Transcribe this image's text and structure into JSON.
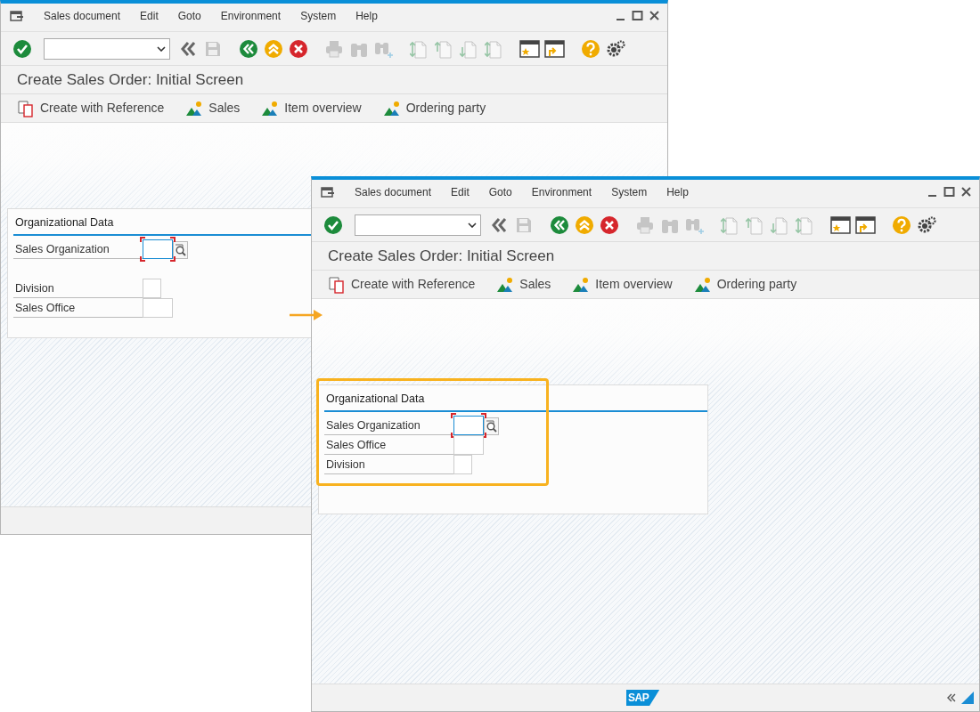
{
  "windows": [
    {
      "menu": [
        {
          "label": "Sales document"
        },
        {
          "label": "Edit"
        },
        {
          "label": "Goto"
        },
        {
          "label": "Environment"
        },
        {
          "label": "System"
        },
        {
          "label": "Help"
        }
      ],
      "toolbar": [
        {
          "kind": "check",
          "disabled": false
        },
        {
          "kind": "command_field",
          "disabled": false
        },
        {
          "kind": "chevrons",
          "disabled": false
        },
        {
          "kind": "save",
          "disabled": true
        },
        {
          "kind": "back",
          "disabled": false
        },
        {
          "kind": "exit",
          "disabled": false
        },
        {
          "kind": "cancel",
          "disabled": false
        },
        {
          "kind": "print",
          "disabled": true
        },
        {
          "kind": "find",
          "disabled": true
        },
        {
          "kind": "find_next",
          "disabled": true
        },
        {
          "kind": "first_page",
          "disabled": true
        },
        {
          "kind": "prev_page",
          "disabled": true
        },
        {
          "kind": "next_page",
          "disabled": true
        },
        {
          "kind": "last_page",
          "disabled": true
        },
        {
          "kind": "new_session",
          "disabled": false
        },
        {
          "kind": "shortcut",
          "disabled": false
        },
        {
          "kind": "help",
          "disabled": false
        },
        {
          "kind": "settings",
          "disabled": false
        }
      ],
      "title": "Create Sales Order: Initial Screen",
      "app_toolbar": [
        {
          "kind": "reference",
          "label": "Create with Reference"
        },
        {
          "kind": "overview",
          "label": "Sales"
        },
        {
          "kind": "overview",
          "label": "Item overview"
        },
        {
          "kind": "overview",
          "label": "Ordering party"
        }
      ],
      "group": {
        "title": "Organizational Data",
        "highlighted": false,
        "fields": [
          {
            "label": "Sales Organization",
            "kind": "long",
            "required": true,
            "focused": true,
            "search_help": true,
            "gap_before": false
          },
          {
            "label": "Division",
            "kind": "short",
            "required": false,
            "focused": false,
            "search_help": false,
            "gap_before": true
          },
          {
            "label": "Sales Office",
            "kind": "long",
            "required": false,
            "focused": false,
            "search_help": false,
            "gap_before": false
          }
        ]
      }
    },
    {
      "menu": [
        {
          "label": "Sales document"
        },
        {
          "label": "Edit"
        },
        {
          "label": "Goto"
        },
        {
          "label": "Environment"
        },
        {
          "label": "System"
        },
        {
          "label": "Help"
        }
      ],
      "toolbar": [
        {
          "kind": "check",
          "disabled": false
        },
        {
          "kind": "command_field",
          "disabled": false
        },
        {
          "kind": "chevrons",
          "disabled": false
        },
        {
          "kind": "save",
          "disabled": true
        },
        {
          "kind": "back",
          "disabled": false
        },
        {
          "kind": "exit",
          "disabled": false
        },
        {
          "kind": "cancel",
          "disabled": false
        },
        {
          "kind": "print",
          "disabled": true
        },
        {
          "kind": "find",
          "disabled": true
        },
        {
          "kind": "find_next",
          "disabled": true
        },
        {
          "kind": "first_page",
          "disabled": true
        },
        {
          "kind": "prev_page",
          "disabled": true
        },
        {
          "kind": "next_page",
          "disabled": true
        },
        {
          "kind": "last_page",
          "disabled": true
        },
        {
          "kind": "new_session",
          "disabled": false
        },
        {
          "kind": "shortcut",
          "disabled": false
        },
        {
          "kind": "help",
          "disabled": false
        },
        {
          "kind": "settings",
          "disabled": false
        }
      ],
      "title": "Create Sales Order: Initial Screen",
      "app_toolbar": [
        {
          "kind": "reference",
          "label": "Create with Reference"
        },
        {
          "kind": "overview",
          "label": "Sales"
        },
        {
          "kind": "overview",
          "label": "Item overview"
        },
        {
          "kind": "overview",
          "label": "Ordering party"
        }
      ],
      "group": {
        "title": "Organizational Data",
        "highlighted": true,
        "fields": [
          {
            "label": "Sales Organization",
            "kind": "long",
            "required": true,
            "focused": true,
            "search_help": true,
            "gap_before": false
          },
          {
            "label": "Sales Office",
            "kind": "long",
            "required": false,
            "focused": false,
            "search_help": false,
            "gap_before": false
          },
          {
            "label": "Division",
            "kind": "short",
            "required": false,
            "focused": false,
            "search_help": false,
            "gap_before": false
          }
        ]
      },
      "status_bar": {
        "logo": "SAP",
        "expand_control": true
      }
    }
  ]
}
